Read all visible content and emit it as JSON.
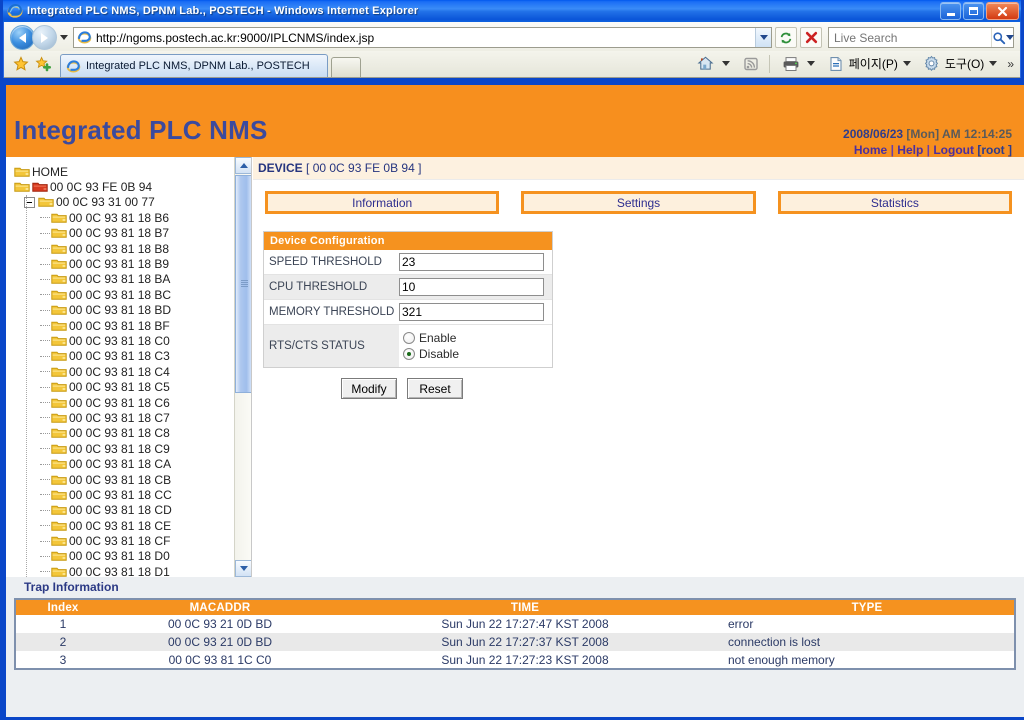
{
  "window": {
    "title": "Integrated PLC NMS, DPNM Lab., POSTECH - Windows Internet Explorer",
    "minimize_label": "Minimize",
    "maximize_label": "Maximize",
    "close_label": "Close"
  },
  "browser": {
    "back_label": "Back",
    "forward_label": "Forward",
    "url": "http://ngoms.postech.ac.kr:9000/IPLCNMS/index.jsp",
    "refresh_label": "Refresh",
    "stop_label": "Stop",
    "search_placeholder": "Live Search",
    "search_value": "",
    "tab_title": "Integrated PLC NMS, DPNM Lab., POSTECH",
    "new_tab_label": "",
    "favorites_label": "Favorites Center",
    "add_favorite_label": "Add to Favorites",
    "home_label": "Home",
    "feeds_label": "Feeds",
    "print_label": "Print",
    "page_menu_label": "페이지(P)",
    "tools_menu_label": "도구(O)",
    "overflow_label": "»"
  },
  "app": {
    "title": "Integrated PLC NMS",
    "datetime_date": "2008/06/23",
    "datetime_day": "[Mon]",
    "datetime_time": "AM 12:14:25",
    "links": {
      "home": "Home",
      "help": "Help",
      "logout": "Logout",
      "user": "[root ]",
      "separator": "|"
    }
  },
  "tree": {
    "nodes": [
      {
        "label": "HOME",
        "depth": 0,
        "icon": "folder-yellow",
        "expander": "none"
      },
      {
        "label": "00 0C 93 FE 0B 94",
        "depth": 0,
        "icon": "folder-red",
        "expander": "none"
      },
      {
        "label": "00 0C 93 31 00 77",
        "depth": 1,
        "icon": "folder-yellow",
        "expander": "minus"
      },
      {
        "label": "00 0C 93 81 18 B6",
        "depth": 2,
        "icon": "folder-yellow",
        "expander": "none"
      },
      {
        "label": "00 0C 93 81 18 B7",
        "depth": 2,
        "icon": "folder-yellow",
        "expander": "none"
      },
      {
        "label": "00 0C 93 81 18 B8",
        "depth": 2,
        "icon": "folder-yellow",
        "expander": "none"
      },
      {
        "label": "00 0C 93 81 18 B9",
        "depth": 2,
        "icon": "folder-yellow",
        "expander": "none"
      },
      {
        "label": "00 0C 93 81 18 BA",
        "depth": 2,
        "icon": "folder-yellow",
        "expander": "none"
      },
      {
        "label": "00 0C 93 81 18 BC",
        "depth": 2,
        "icon": "folder-yellow",
        "expander": "none"
      },
      {
        "label": "00 0C 93 81 18 BD",
        "depth": 2,
        "icon": "folder-yellow",
        "expander": "none"
      },
      {
        "label": "00 0C 93 81 18 BF",
        "depth": 2,
        "icon": "folder-yellow",
        "expander": "none"
      },
      {
        "label": "00 0C 93 81 18 C0",
        "depth": 2,
        "icon": "folder-yellow",
        "expander": "none"
      },
      {
        "label": "00 0C 93 81 18 C3",
        "depth": 2,
        "icon": "folder-yellow",
        "expander": "none"
      },
      {
        "label": "00 0C 93 81 18 C4",
        "depth": 2,
        "icon": "folder-yellow",
        "expander": "none"
      },
      {
        "label": "00 0C 93 81 18 C5",
        "depth": 2,
        "icon": "folder-yellow",
        "expander": "none"
      },
      {
        "label": "00 0C 93 81 18 C6",
        "depth": 2,
        "icon": "folder-yellow",
        "expander": "none"
      },
      {
        "label": "00 0C 93 81 18 C7",
        "depth": 2,
        "icon": "folder-yellow",
        "expander": "none"
      },
      {
        "label": "00 0C 93 81 18 C8",
        "depth": 2,
        "icon": "folder-yellow",
        "expander": "none"
      },
      {
        "label": "00 0C 93 81 18 C9",
        "depth": 2,
        "icon": "folder-yellow",
        "expander": "none"
      },
      {
        "label": "00 0C 93 81 18 CA",
        "depth": 2,
        "icon": "folder-yellow",
        "expander": "none"
      },
      {
        "label": "00 0C 93 81 18 CB",
        "depth": 2,
        "icon": "folder-yellow",
        "expander": "none"
      },
      {
        "label": "00 0C 93 81 18 CC",
        "depth": 2,
        "icon": "folder-yellow",
        "expander": "none"
      },
      {
        "label": "00 0C 93 81 18 CD",
        "depth": 2,
        "icon": "folder-yellow",
        "expander": "none"
      },
      {
        "label": "00 0C 93 81 18 CE",
        "depth": 2,
        "icon": "folder-yellow",
        "expander": "none"
      },
      {
        "label": "00 0C 93 81 18 CF",
        "depth": 2,
        "icon": "folder-yellow",
        "expander": "none"
      },
      {
        "label": "00 0C 93 81 18 D0",
        "depth": 2,
        "icon": "folder-yellow",
        "expander": "none"
      },
      {
        "label": "00 0C 93 81 18 D1",
        "depth": 2,
        "icon": "folder-yellow",
        "expander": "none"
      }
    ]
  },
  "device": {
    "header_prefix": "DEVICE",
    "header_mac": "[ 00 0C 93 FE 0B 94 ]",
    "tabs": [
      {
        "label": "Information"
      },
      {
        "label": "Settings"
      },
      {
        "label": "Statistics"
      }
    ],
    "config": {
      "panel_title": "Device Configuration",
      "rows": [
        {
          "label": "SPEED THRESHOLD",
          "value": "23"
        },
        {
          "label": "CPU THRESHOLD",
          "value": "10"
        },
        {
          "label": "MEMORY THRESHOLD",
          "value": "321"
        }
      ],
      "rts_label": "RTS/CTS STATUS",
      "rts_options": [
        {
          "label": "Enable",
          "selected": false
        },
        {
          "label": "Disable",
          "selected": true
        }
      ],
      "modify_label": "Modify",
      "reset_label": "Reset"
    }
  },
  "trap": {
    "title": "Trap Information",
    "columns": [
      "Index",
      "MACADDR",
      "TIME",
      "TYPE"
    ],
    "rows": [
      {
        "index": "1",
        "mac": "00 0C 93 21 0D BD",
        "time": "Sun Jun 22 17:27:47 KST 2008",
        "type": "error"
      },
      {
        "index": "2",
        "mac": "00 0C 93 21 0D BD",
        "time": "Sun Jun 22 17:27:37 KST 2008",
        "type": "connection is lost"
      },
      {
        "index": "3",
        "mac": "00 0C 93 81 1C C0",
        "time": "Sun Jun 22 17:27:23 KST 2008",
        "type": "not enough memory"
      }
    ]
  },
  "colors": {
    "accent_orange": "#f5921f",
    "header_orange": "#f78f1e",
    "title_blue": "#3b4a9e",
    "link_purple": "#4b2fa0",
    "table_row_alt": "#e9e9e9",
    "tab_fill": "#fdf0dd"
  }
}
